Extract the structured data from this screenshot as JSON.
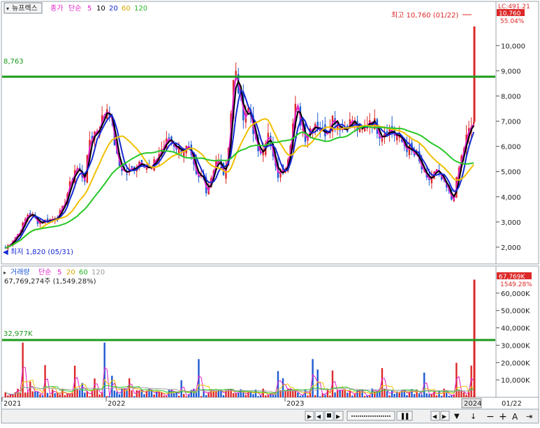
{
  "legend_price": {
    "stock_name": "뉴프렉스",
    "close_label": "종가",
    "ma_label": "단순",
    "periods": [
      "5",
      "10",
      "20",
      "60",
      "120"
    ],
    "ma_colors": [
      "#e020c8",
      "#000000",
      "#1428d2",
      "#f0c000",
      "#28c828"
    ]
  },
  "legend_volume": {
    "title": "거래량",
    "ma_label": "단순",
    "periods": [
      "5",
      "20",
      "60",
      "120"
    ],
    "ma_colors": [
      "#e020c8",
      "#f0c000",
      "#28c828",
      "#a0a0a0"
    ],
    "current": "67,769,274주 (1,549.28%)"
  },
  "price_labels": {
    "hline_value": "8,763",
    "high_note": "최고 10,760 (01/22)",
    "low_note": "최저 1,820 (05/31)",
    "lc_label": "LC:491.21",
    "current_price": "10,760",
    "change_pct": "55.04%"
  },
  "volume_labels": {
    "hline_value": "32,977K",
    "current_volume": "67,769K",
    "current_pct": "1549.28%"
  },
  "x_axis": [
    "2021",
    "2022",
    "2023",
    "2024",
    "01/22"
  ],
  "colors": {
    "up": "#dc2828",
    "down": "#1e5ad2",
    "hline": "#1a9a1a",
    "current_tag": "#dc2828"
  },
  "chart_data": {
    "type": "candlestick",
    "price_axis": {
      "ticks": [
        "2,000",
        "3,000",
        "4,000",
        "5,000",
        "6,000",
        "7,000",
        "8,000",
        "9,000",
        "10,000"
      ],
      "range": [
        1500,
        11200
      ]
    },
    "volume_axis": {
      "ticks": [
        "10,000K",
        "20,000K",
        "30,000K",
        "40,000K",
        "50,000K",
        "60,000K"
      ],
      "range": [
        0,
        70000
      ]
    },
    "horizontal_lines": {
      "price": 8763,
      "volume": 32977
    },
    "high": {
      "value": 10760,
      "date": "01/22"
    },
    "low": {
      "value": 1820,
      "date": "05/31"
    },
    "close_path": [
      [
        0.0,
        1950
      ],
      [
        0.03,
        2600
      ],
      [
        0.05,
        3400
      ],
      [
        0.07,
        3000
      ],
      [
        0.1,
        3100
      ],
      [
        0.12,
        3400
      ],
      [
        0.15,
        5200
      ],
      [
        0.17,
        4700
      ],
      [
        0.18,
        6300
      ],
      [
        0.2,
        6800
      ],
      [
        0.22,
        7700
      ],
      [
        0.24,
        5300
      ],
      [
        0.26,
        4900
      ],
      [
        0.29,
        5500
      ],
      [
        0.31,
        5000
      ],
      [
        0.33,
        5800
      ],
      [
        0.35,
        6300
      ],
      [
        0.37,
        5900
      ],
      [
        0.39,
        5900
      ],
      [
        0.41,
        4600
      ],
      [
        0.42,
        4900
      ],
      [
        0.43,
        4200
      ],
      [
        0.45,
        5500
      ],
      [
        0.47,
        4800
      ],
      [
        0.49,
        9300
      ],
      [
        0.51,
        6800
      ],
      [
        0.52,
        7600
      ],
      [
        0.54,
        5600
      ],
      [
        0.56,
        6500
      ],
      [
        0.58,
        4800
      ],
      [
        0.6,
        5300
      ],
      [
        0.62,
        7600
      ],
      [
        0.64,
        6400
      ],
      [
        0.66,
        7000
      ],
      [
        0.68,
        6500
      ],
      [
        0.7,
        7200
      ],
      [
        0.72,
        6700
      ],
      [
        0.74,
        7000
      ],
      [
        0.76,
        6500
      ],
      [
        0.78,
        7200
      ],
      [
        0.8,
        6500
      ],
      [
        0.82,
        6700
      ],
      [
        0.84,
        6300
      ],
      [
        0.86,
        5900
      ],
      [
        0.88,
        5500
      ],
      [
        0.9,
        4600
      ],
      [
        0.92,
        5000
      ],
      [
        0.94,
        4400
      ],
      [
        0.955,
        3800
      ],
      [
        0.97,
        5300
      ],
      [
        0.985,
        6400
      ],
      [
        1.0,
        7000
      ]
    ],
    "last_bar": {
      "high": 10760,
      "close": 10760,
      "volume": 67769
    }
  }
}
